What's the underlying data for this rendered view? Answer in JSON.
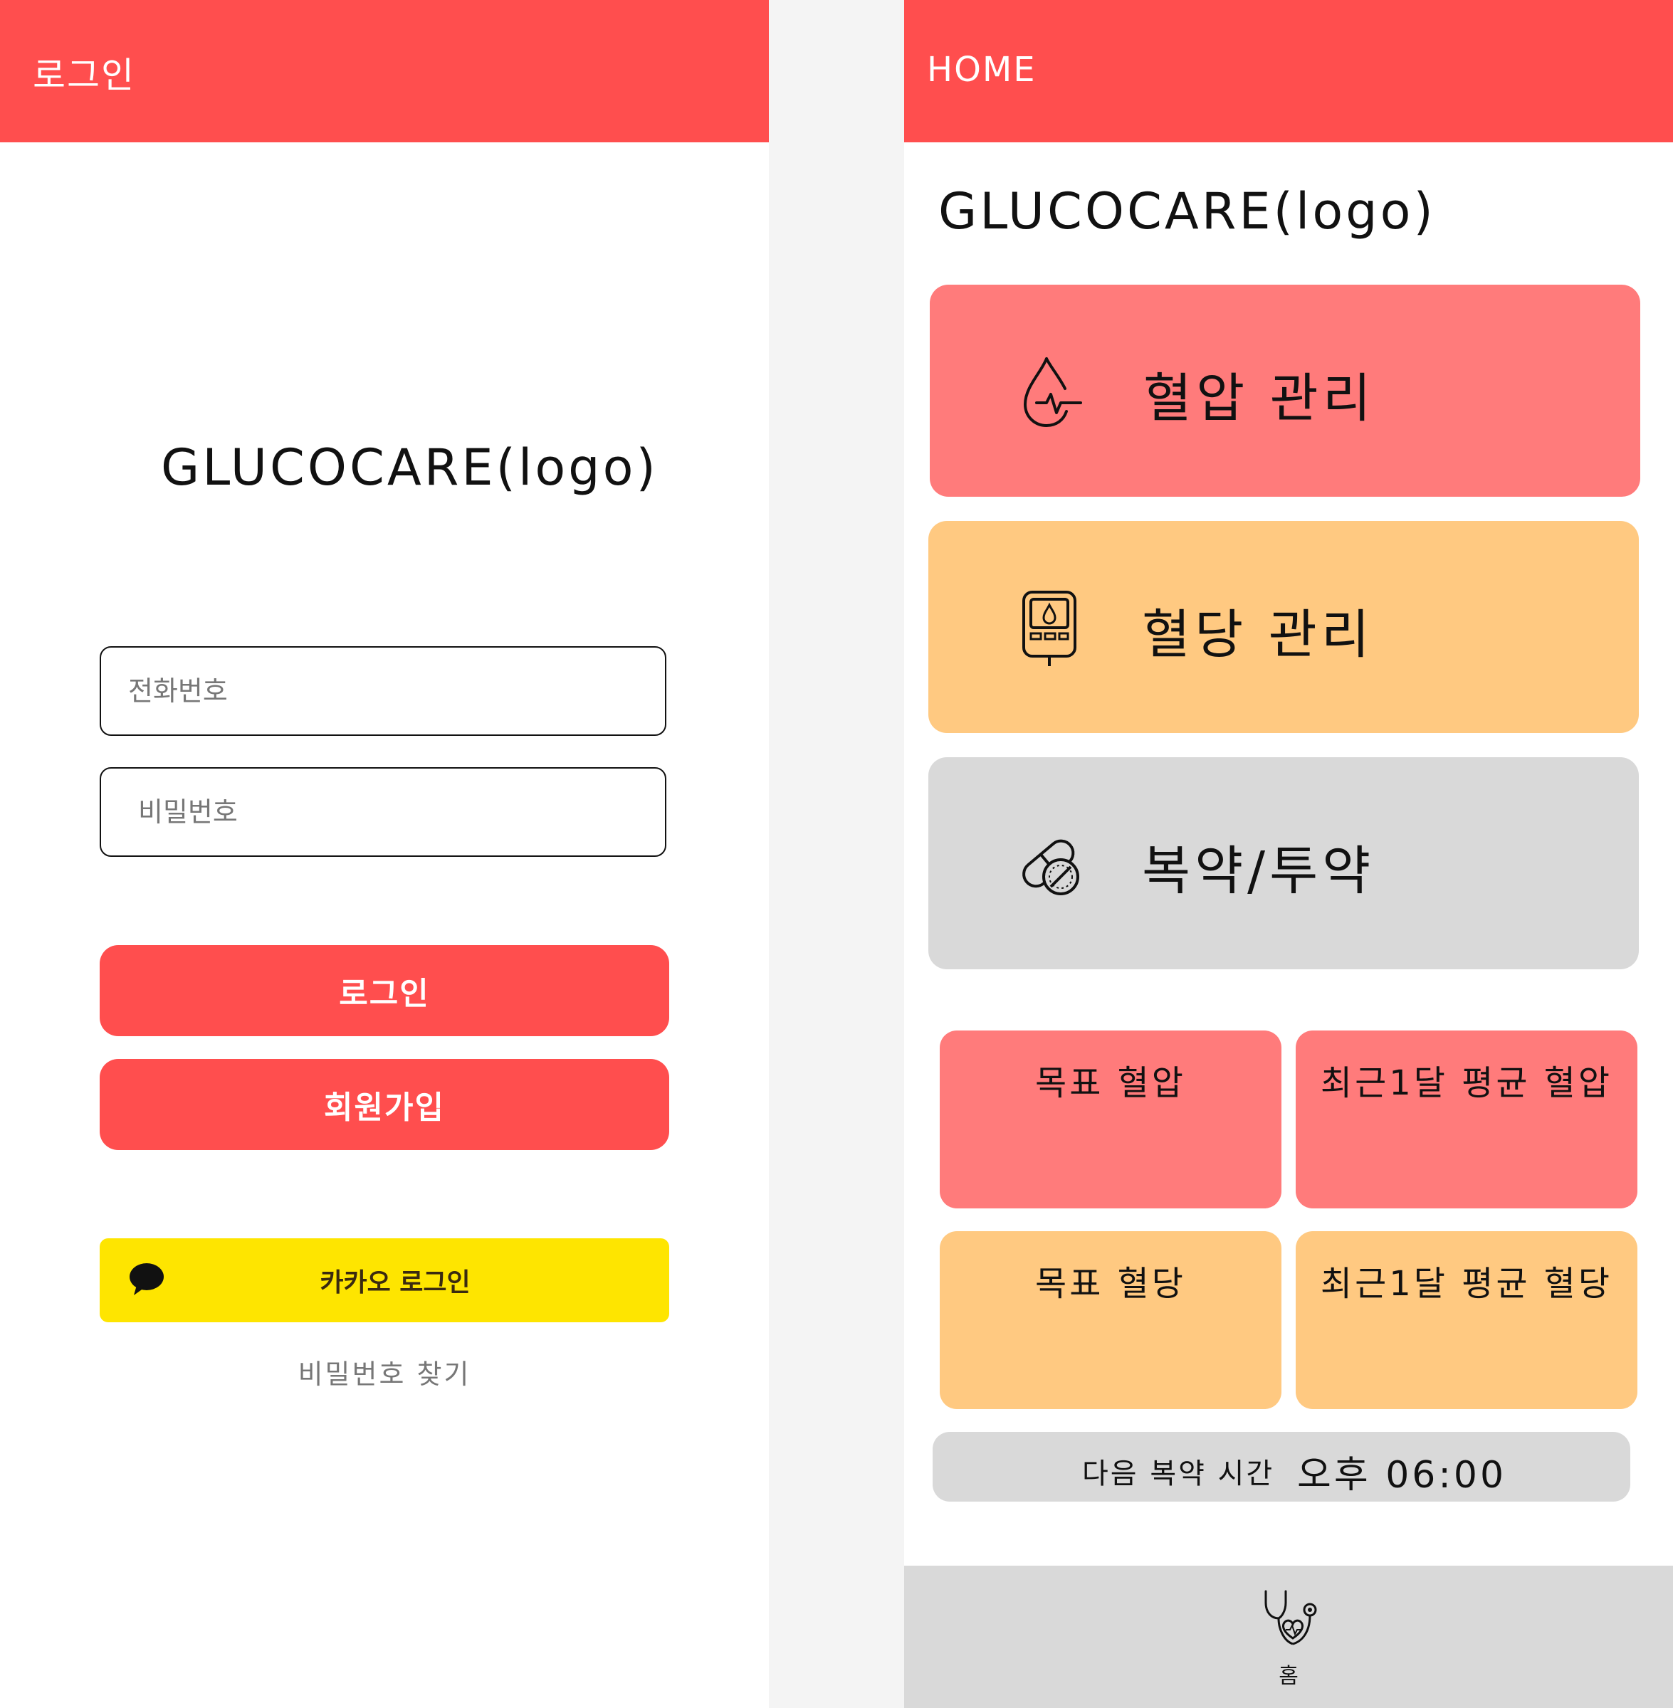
{
  "login": {
    "appbar_title": "로그인",
    "logo": "GLUCOCARE(logo)",
    "phone_placeholder": "전화번호",
    "password_placeholder": "비밀번호",
    "login_button": "로그인",
    "signup_button": "회원가입",
    "kakao_button": "카카오 로그인",
    "find_password": "비밀번호 찾기"
  },
  "home": {
    "appbar_title": "HOME",
    "logo": "GLUCOCARE(logo)",
    "menu": [
      {
        "label": "혈압 관리",
        "icon": "blood-drop-pulse-icon",
        "color": "#ff7b7b"
      },
      {
        "label": "혈당 관리",
        "icon": "glucose-meter-icon",
        "color": "#ffc981"
      },
      {
        "label": "복약/투약",
        "icon": "pills-icon",
        "color": "#d9d9d9"
      }
    ],
    "stats": [
      {
        "label": "목표 혈압",
        "color": "#ff7b7b"
      },
      {
        "label": "최근1달 평균 혈압",
        "color": "#ff7b7b"
      },
      {
        "label": "목표 혈당",
        "color": "#ffc981"
      },
      {
        "label": "최근1달 평균 혈당",
        "color": "#ffc981"
      }
    ],
    "next_dose_label": "다음 복약 시간",
    "next_dose_time": "오후 06:00",
    "nav": [
      {
        "label": "홈",
        "icon": "stethoscope-heart-icon"
      }
    ]
  },
  "colors": {
    "primary": "#ff4e4e",
    "pink": "#ff7b7b",
    "orange": "#ffc981",
    "gray": "#d9d9d9",
    "kakao": "#fee500"
  }
}
